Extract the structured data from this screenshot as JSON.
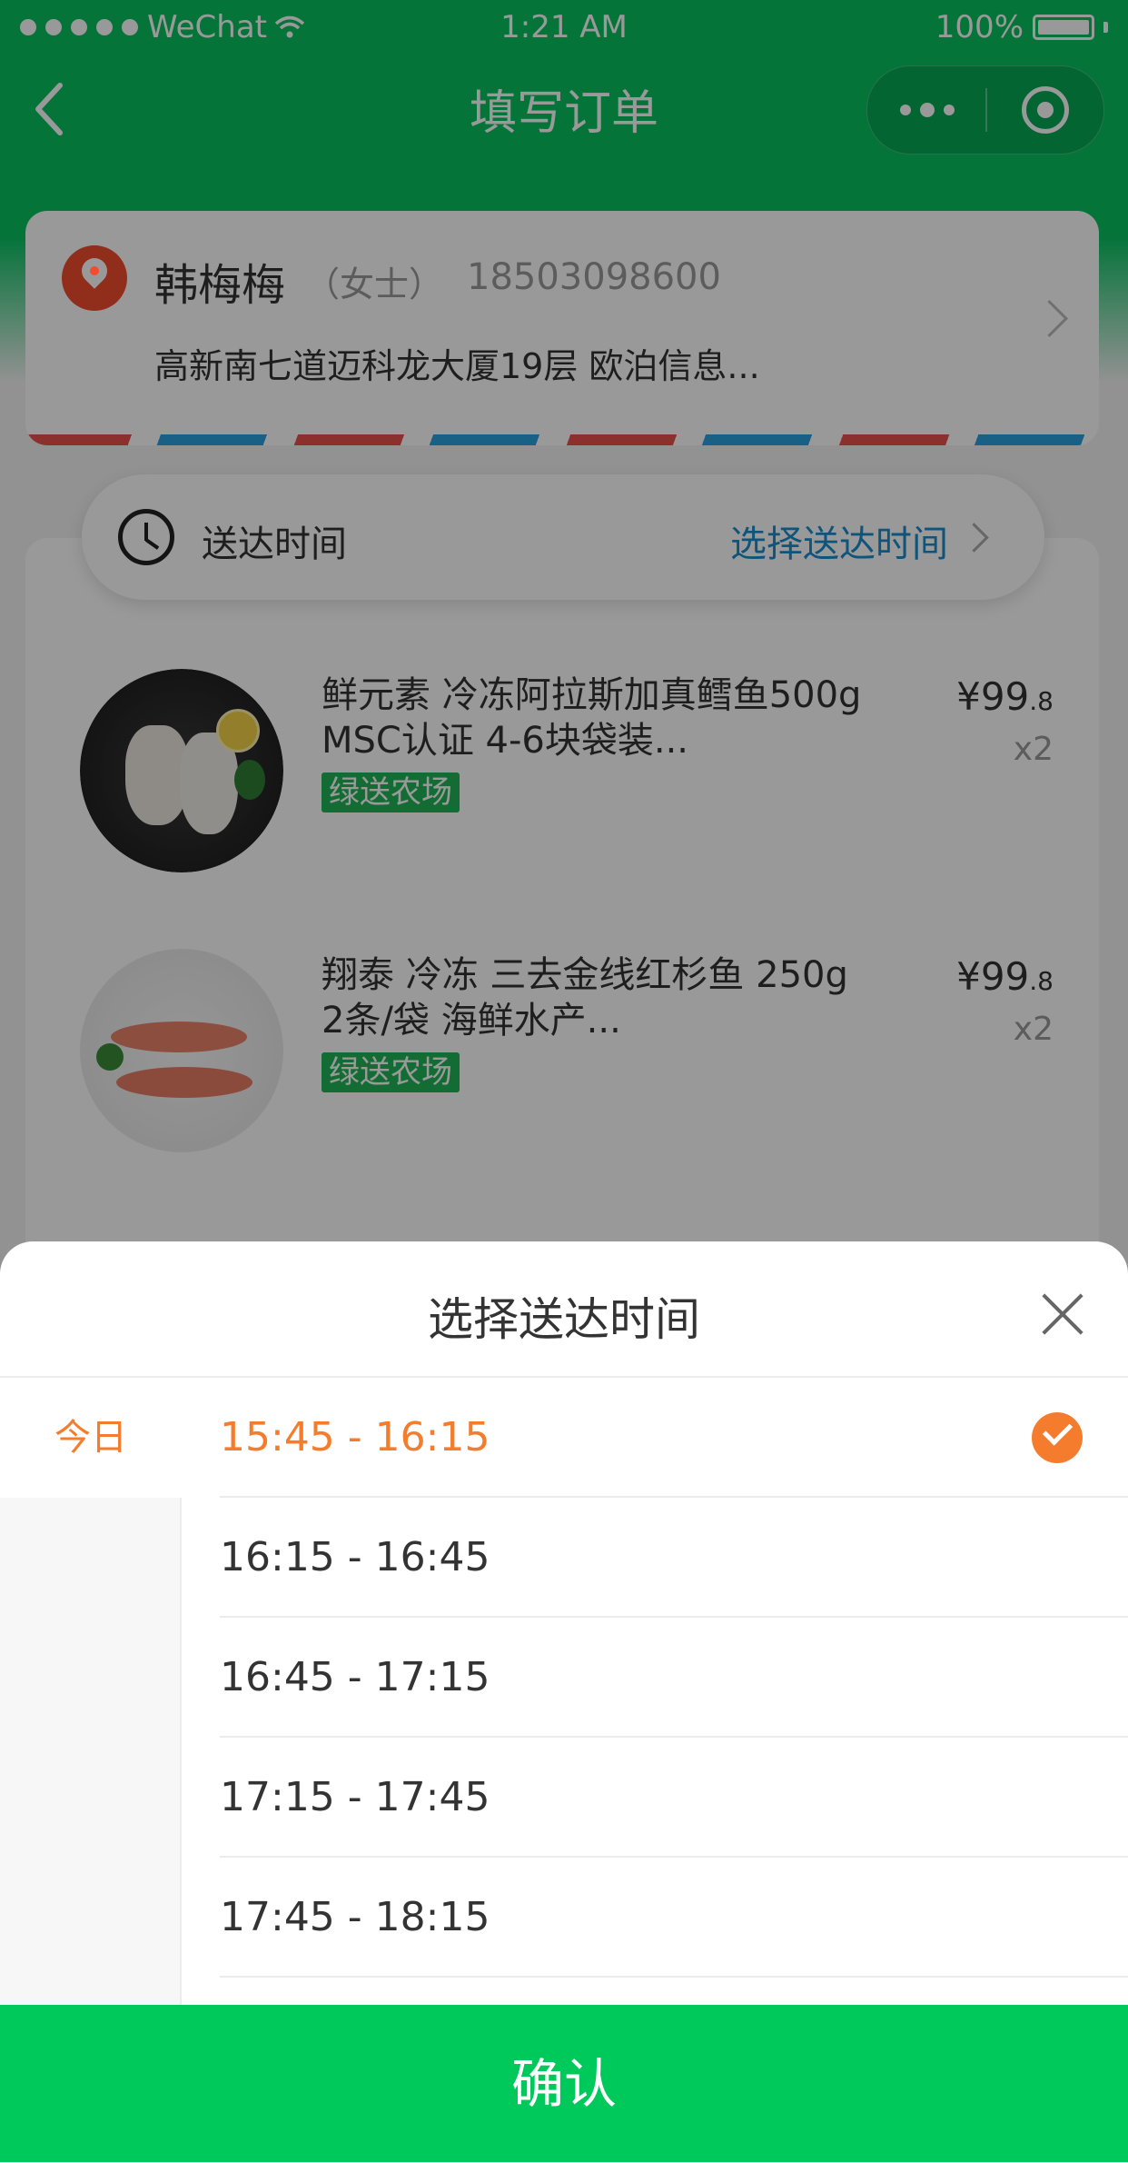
{
  "status_bar": {
    "carrier": "WeChat",
    "time": "1:21 AM",
    "battery": "100%"
  },
  "nav": {
    "title": "填写订单"
  },
  "address": {
    "name": "韩梅梅",
    "gender": "（女士）",
    "phone": "18503098600",
    "line": "高新南七道迈科龙大厦19层 欧泊信息..."
  },
  "delivery": {
    "label": "送达时间",
    "select_text": "选择送达时间"
  },
  "products": [
    {
      "name": "鲜元素 冷冻阿拉斯加真鳕鱼500g MSC认证 4-6块袋装...",
      "tag": "绿送农场",
      "price_main": "¥99",
      "price_dec": ".8",
      "qty": "x2"
    },
    {
      "name": "翔泰 冷冻 三去金线红杉鱼 250g 2条/袋 海鲜水产...",
      "tag": "绿送农场",
      "price_main": "¥99",
      "price_dec": ".8",
      "qty": "x2"
    }
  ],
  "sheet": {
    "title": "选择送达时间",
    "day": "今日",
    "slots": [
      "15:45 - 16:15",
      "16:15 - 16:45",
      "16:45 - 17:15",
      "17:15 - 17:45",
      "17:45 - 18:15"
    ],
    "selected_index": 0,
    "confirm_label": "确认"
  },
  "colors": {
    "brand_green": "#07c160",
    "confirm_green": "#00c95c",
    "accent_orange": "#f57c2c",
    "link_blue": "#1a8ccc",
    "tag_green": "#1fb556"
  }
}
